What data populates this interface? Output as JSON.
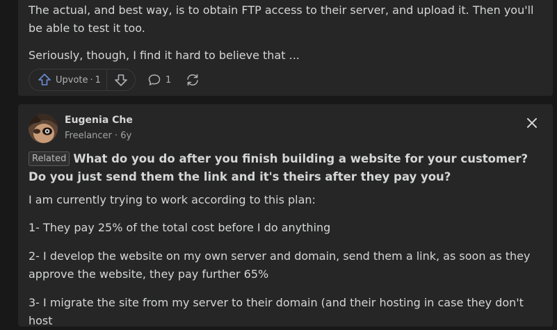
{
  "prev_answer": {
    "paragraph1": "The actual, and best way, is to obtain FTP access to their server, and upload it. Then you'll be able to test it too.",
    "paragraph2": "Seriously, though, I find it hard to believe that ...",
    "upvote_label": "Upvote",
    "upvote_count": "1",
    "comment_count": "1"
  },
  "answer": {
    "author_name": "Eugenia Che",
    "author_meta": "Freelancer · 6y",
    "badge": "Related",
    "question": "What do you do after you finish building a website for your customer? Do you just send them the link and it's theirs after they pay you?",
    "body": [
      "I am currently trying to work according to this plan:",
      "1- They pay 25% of the total cost before I do anything",
      "2- I develop the website on my own server and domain, send them a link, as soon as they approve the website, they pay further 65%",
      "3- I migrate the site from my server to their domain (and their hosting in case they don't host"
    ]
  },
  "colors": {
    "background": "#181818",
    "card": "#262626",
    "text": "#d5d6d6",
    "muted": "#a3a5a8",
    "upvote_icon": "#6c8ed8"
  },
  "icons": [
    "upvote-icon",
    "downvote-icon",
    "comment-icon",
    "share-icon",
    "close-icon"
  ]
}
